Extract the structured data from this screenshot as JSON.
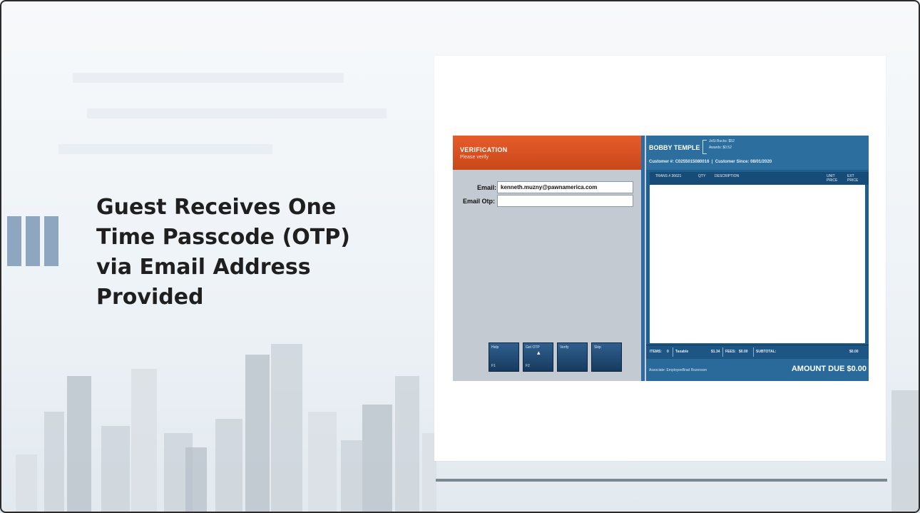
{
  "slide": {
    "title": "Guest Receives One\nTime Passcode (OTP)\nvia Email Address\nProvided"
  },
  "verification": {
    "title": "VERIFICATION",
    "subtitle": "Please verify"
  },
  "form": {
    "email_label": "Email:",
    "email_value": "kenneth.muzny@pawnamerica.com",
    "otp_label": "Email Otp:",
    "otp_value": ""
  },
  "function_keys": [
    {
      "label": "Help",
      "key": "F1"
    },
    {
      "label": "Get OTP",
      "key": "F2"
    },
    {
      "label": "Verify",
      "key": ""
    },
    {
      "label": "Skip",
      "key": ""
    }
  ],
  "customer": {
    "name": "BOBBY TEMPLE",
    "points_line1": "JoSi Bucks: $52",
    "points_line2": "Awards: $0.52",
    "number_label": "Customer #:",
    "number_value": "C0255015080016",
    "since_label": "Customer Since:",
    "since_value": "08/01/2020"
  },
  "table": {
    "columns": [
      "TRANS # 36621",
      "QTY",
      "DESCRIPTION",
      "UNIT PRICE",
      "EXT PRICE"
    ]
  },
  "totals": {
    "items_label": "ITEMS:",
    "items_value": "0",
    "taxable_label": "Taxable",
    "taxable_value": "$1.34",
    "fees_label": "FEES:",
    "fees_value": "$0.00",
    "subtotal_label": "SUBTOTAL:",
    "subtotal_value": "$0.00"
  },
  "footer": {
    "associate": "Associate: EmployeeBrad Rozenson",
    "amount_due": "AMOUNT DUE $0.00"
  },
  "colors": {
    "accent_orange": "#e65c2a",
    "pos_blue": "#1f5f8f",
    "accent_bar": "#8fa6c0"
  }
}
